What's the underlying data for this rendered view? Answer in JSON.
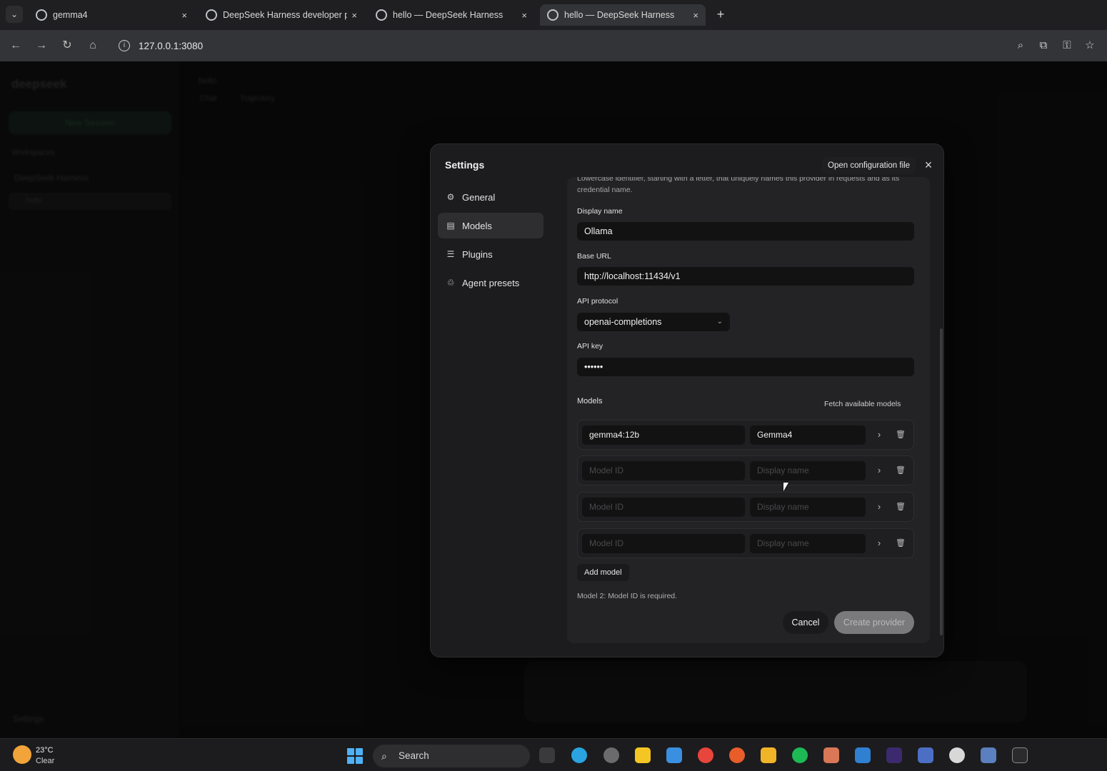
{
  "browser": {
    "tabs": [
      {
        "title": "gemma4",
        "active": false
      },
      {
        "title": "DeepSeek Harness developer p",
        "active": false
      },
      {
        "title": "hello — DeepSeek Harness",
        "active": false
      },
      {
        "title": "hello — DeepSeek Harness",
        "active": true
      }
    ],
    "new_tab_label": "+",
    "close_label": "×",
    "url": "127.0.0.1:3080"
  },
  "app": {
    "brand": "deepseek",
    "new_session": "New Session",
    "workspaces_label": "Workspaces",
    "workspace_item": "DeepSeek Harness",
    "session_item": "hello",
    "settings_label": "Settings",
    "main_title": "hello",
    "main_tab": "Chat",
    "main_tab2": "Trajectory"
  },
  "settings": {
    "title": "Settings",
    "open_config_label": "Open configuration file",
    "nav": [
      {
        "label": "General",
        "icon": "gear-icon",
        "active": false
      },
      {
        "label": "Models",
        "icon": "models-icon",
        "active": true
      },
      {
        "label": "Plugins",
        "icon": "plugins-icon",
        "active": false
      },
      {
        "label": "Agent presets",
        "icon": "agent-icon",
        "active": false
      }
    ],
    "help_text": "Lowercase identifier, starting with a letter, that uniquely names this provider in requests and as its credential name.",
    "fields": {
      "display_name_label": "Display name",
      "display_name_value": "Ollama",
      "base_url_label": "Base URL",
      "base_url_value": "http://localhost:11434/v1",
      "api_protocol_label": "API protocol",
      "api_protocol_value": "openai-completions",
      "api_key_label": "API key",
      "api_key_value": "••••••"
    },
    "models_label": "Models",
    "fetch_label": "Fetch available models",
    "models": [
      {
        "id": "gemma4:12b",
        "name": "Gemma4"
      },
      {
        "id": "",
        "name": ""
      },
      {
        "id": "",
        "name": ""
      },
      {
        "id": "",
        "name": ""
      }
    ],
    "model_id_placeholder": "Model ID",
    "display_name_placeholder": "Display name",
    "add_model_label": "Add model",
    "error_text": "Model 2: Model ID is required.",
    "cancel_label": "Cancel",
    "create_label": "Create provider"
  },
  "taskbar": {
    "temperature": "23°C",
    "condition": "Clear",
    "search_label": "Search"
  },
  "colors": {
    "accent": "#4fb2f7",
    "modal_bg": "#1c1c1e",
    "input_bg": "#121213"
  }
}
